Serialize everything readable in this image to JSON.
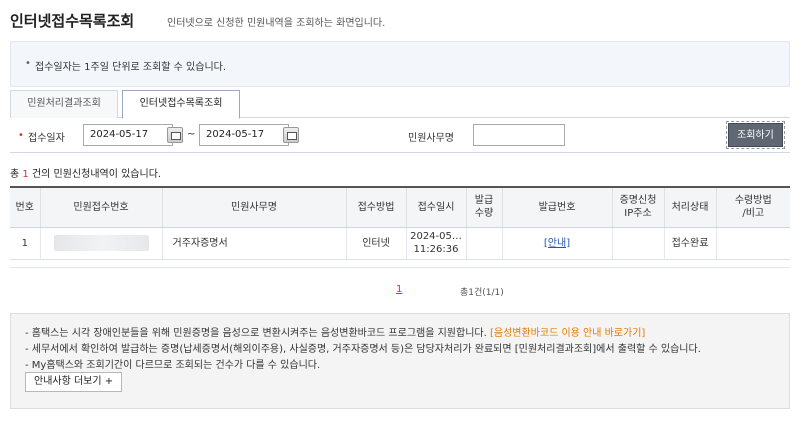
{
  "header": {
    "title": "인터넷접수목록조회",
    "description": "인터넷으로 신청한 민원내역을 조회하는 화면입니다."
  },
  "notice": {
    "bullet": "•",
    "text": "접수일자는 1주일 단위로 조회할 수 있습니다."
  },
  "tabs": [
    {
      "label": "민원처리결과조회",
      "active": false
    },
    {
      "label": "인터넷접수목록조회",
      "active": true
    }
  ],
  "search": {
    "required_mark": "•",
    "date_label": "접수일자",
    "date_from": "2024-05-17",
    "date_to": "2024-05-17",
    "separator": "~",
    "office_label": "민원사무명",
    "office_value": "",
    "search_button": "조회하기"
  },
  "result": {
    "prefix": "총",
    "count": "1",
    "suffix": "건의 민원신청내역이 있습니다."
  },
  "table": {
    "headers": [
      "번호",
      "민원접수번호",
      "민원사무명",
      "접수방법",
      "접수일시",
      "발급\n수량",
      "발급번호",
      "증명신청\nIP주소",
      "처리상태",
      "수령방법\n/비고"
    ],
    "rows": [
      {
        "no": "1",
        "receipt_no": "",
        "office_name": "거주자증명서",
        "method": "인터넷",
        "date": "2024-05…",
        "time": "11:26:36",
        "qty": "",
        "issue_no": "[안내]",
        "ip": "",
        "status": "접수완료",
        "remark": ""
      }
    ]
  },
  "pagination": {
    "current": "1",
    "total": "총1건(1/1)"
  },
  "info": {
    "line1_text": "- 홈택스는 시각 장애인분들을 위해 민원증명을 음성으로 변환시켜주는 음성변환바코드 프로그램을 지원합니다.",
    "line1_link": "[음성변환바코드 이용 안내 바로가기]",
    "line2": "- 세무서에서 확인하여 발급하는 증명(납세증명서(해외이주용), 사실증명, 거주자증명서 등)은 담당자처리가 완료되면 [민원처리결과조회]에서 출력할 수 있습니다.",
    "line3": "- My홈택스와 조회기간이 다르므로 조회되는 건수가 다를 수 있습니다.",
    "more_button": "안내사항 더보기 +"
  },
  "colors": {
    "accent_red": "#dd3322",
    "link_blue": "#2355b2",
    "link_orange": "#e07b00",
    "button_dark": "#5f6773"
  }
}
